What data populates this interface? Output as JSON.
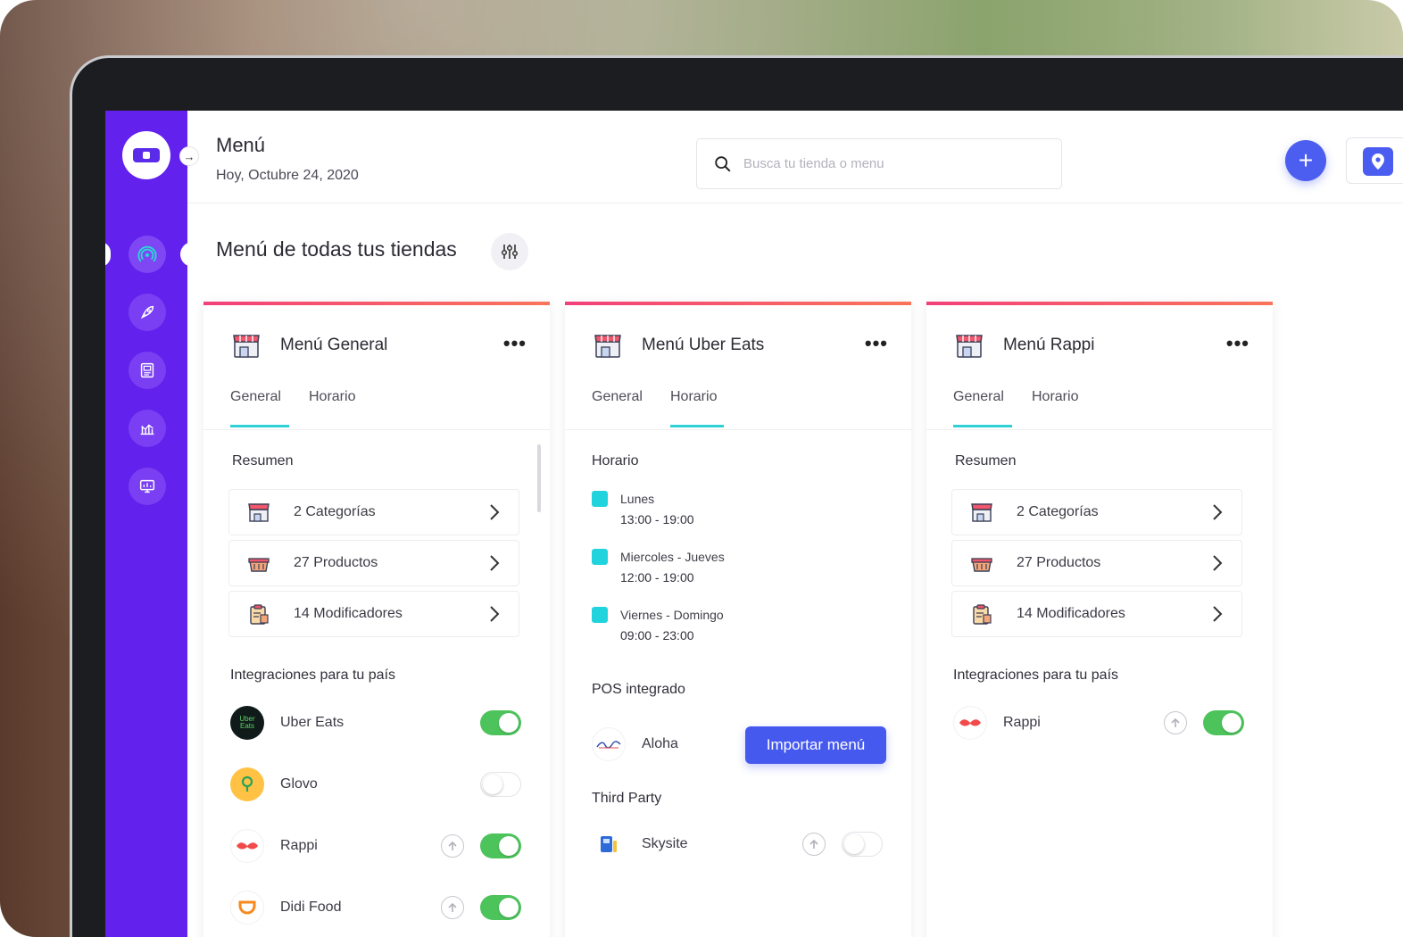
{
  "header": {
    "title": "Menú",
    "date": "Hoy, Octubre 24, 2020",
    "search_placeholder": "Busca tu tienda o menu"
  },
  "section_title": "Menú de todas tus tiendas",
  "tabs": {
    "general": "General",
    "schedule": "Horario"
  },
  "card_general": {
    "title": "Menú General",
    "active_tab": "General",
    "summary_title": "Resumen",
    "rows": [
      "2 Categorías",
      "27 Productos",
      "14 Modificadores"
    ],
    "integrations_title": "Integraciones para tu país",
    "integrations": [
      {
        "name": "Uber Eats",
        "enabled": true
      },
      {
        "name": "Glovo",
        "enabled": false
      },
      {
        "name": "Rappi",
        "enabled": true
      },
      {
        "name": "Didi Food",
        "enabled": true
      }
    ],
    "uber_logo_text": "Uber Eats"
  },
  "card_uber": {
    "title": "Menú Uber Eats",
    "active_tab": "Horario",
    "schedule_title": "Horario",
    "schedule": [
      {
        "days": "Lunes",
        "hours": "13:00 - 19:00"
      },
      {
        "days": "Miercoles - Jueves",
        "hours": "12:00 - 19:00"
      },
      {
        "days": "Viernes - Domingo",
        "hours": "09:00 - 23:00"
      }
    ],
    "pos_title": "POS integrado",
    "pos_name": "Aloha",
    "import_label": "Importar menú",
    "third_party_title": "Third Party",
    "third_party": [
      {
        "name": "Skysite",
        "enabled": false
      }
    ]
  },
  "card_rappi": {
    "title": "Menú Rappi",
    "active_tab": "General",
    "summary_title": "Resumen",
    "rows": [
      "2 Categorías",
      "27 Productos",
      "14 Modificadores"
    ],
    "integrations_title": "Integraciones para tu país",
    "integrations": [
      {
        "name": "Rappi",
        "enabled": true
      }
    ]
  },
  "icons": {
    "sidebar": [
      "wifi-broadcast-icon",
      "rocket-icon",
      "menu-book-icon",
      "chart-icon",
      "monitor-chart-icon"
    ],
    "search": "search-icon",
    "add": "plus-icon",
    "location": "location-pin-icon",
    "filter": "sliders-icon"
  },
  "colors": {
    "sidebar": "#6221ec",
    "primary_button": "#4659ef",
    "tab_underline": "#2fd0d6",
    "toggle_on": "#4cc35b",
    "card_accent_start": "#f3407a",
    "card_accent_end": "#f9755a",
    "schedule_marker": "#21d3dc"
  }
}
